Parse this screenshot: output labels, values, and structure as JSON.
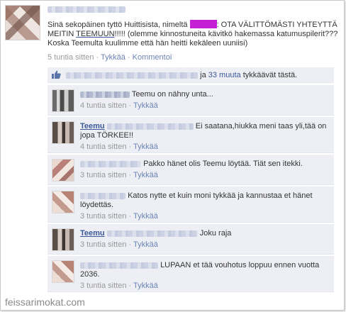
{
  "post": {
    "text_line1_pre": "Sinä sekopäinen tyttö Huittisista, nimeltä",
    "text_line1_post": ": OTA VÄLITTÖMÄSTI YHTEYTTÄ",
    "text_line2_pre": "MEITIN",
    "text_line2_link": "TEEMUUN",
    "text_line2_post": "!!!!! (olemme kinnostuneita kävitkö hakemassa katumuspilerit???",
    "text_line3": "Koska Teemulta kuulimme että hän heitti kekäleen uuniisi)",
    "time": "5 tuntia sitten",
    "sep": " · ",
    "like": "Tykkää",
    "comment": "Kommentoi"
  },
  "likes": {
    "connector": "ja",
    "others_link": "33 muuta",
    "suffix": "tykkäävät tästä."
  },
  "comments": [
    {
      "name": "",
      "text": "Teemu on nähny unta...",
      "time": "4 tuntia sitten",
      "like": "Tykkää"
    },
    {
      "name": "Teemu",
      "text": "Ei saatana,hiukka meni taas yli,tää on jopa TÖRKEE!!",
      "time": "4 tuntia sitten",
      "like": "Tykkää"
    },
    {
      "name": "",
      "text": "Pakko hänet olis Teemu löytää. Tiät sen itekki.",
      "time": "3 tuntia sitten",
      "like": "Tykkää"
    },
    {
      "name": "",
      "text": "Katos nytte et kuin moni tykkää ja kannustaa et hänet löydettäs.",
      "time": "3 tuntia sitten",
      "like": "Tykkää"
    },
    {
      "name": "Teemu",
      "text": "Joku raja",
      "time": "3 tuntia sitten",
      "like": "Tykkää"
    },
    {
      "name": "",
      "text": "LUPAAN et tää vouhotus loppuu ennen vuotta 2036.",
      "time": "3 tuntia sitten",
      "like": "Tykkää"
    }
  ],
  "watermark": "feissarimokat.com",
  "colors": {
    "link": "#3b5998",
    "meta_link": "#6d84b4",
    "panel": "#edeff4",
    "redaction": "#c51fd6"
  }
}
